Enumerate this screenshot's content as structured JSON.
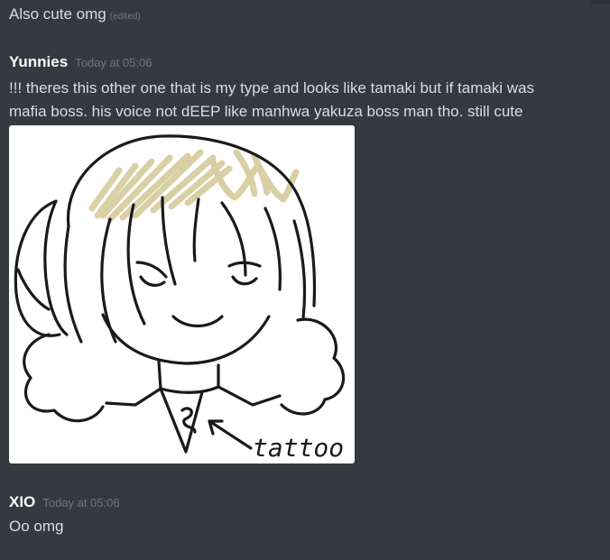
{
  "messages": [
    {
      "text": "Also cute omg",
      "edited_label": "(edited)"
    },
    {
      "author": "Yunnies",
      "timestamp": "Today at 05:06",
      "line1": "!!! theres this other one that is my type and looks like tamaki but if tamaki was",
      "line2": "mafia boss. his voice not dEEP like manhwa yakuza boss man tho. still cute",
      "attachment": {
        "annotation_text": "tattoo",
        "hair_color": "#d8cda0",
        "ink_color": "#1a1a1a"
      }
    },
    {
      "author": "XIO",
      "timestamp": "Today at 05:06",
      "text": "Oo omg"
    }
  ],
  "theme": {
    "background": "#36393f",
    "text": "#dcddde",
    "muted": "#72767d",
    "username": "#ffffff"
  }
}
